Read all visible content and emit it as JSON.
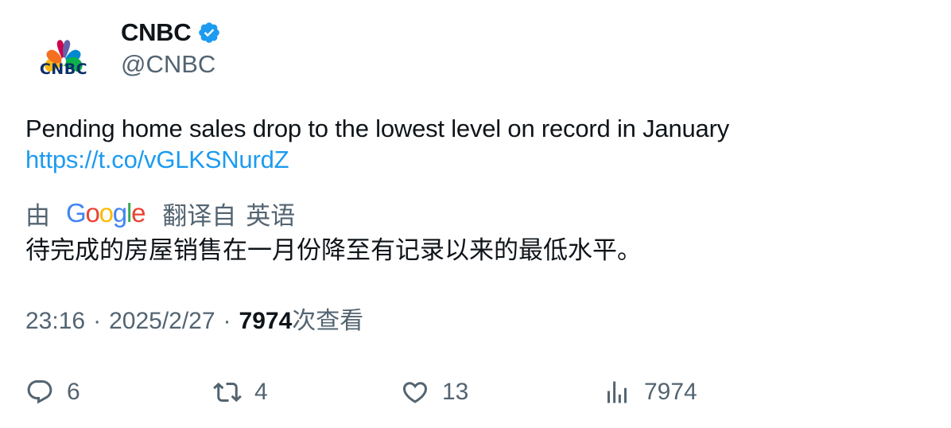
{
  "author": {
    "name": "CNBC",
    "handle": "@CNBC",
    "avatar_text": "CNBC",
    "verified_color": "#1d9bf0"
  },
  "tweet": {
    "text": "Pending home sales drop to the lowest level on record in January",
    "link": "https://t.co/vGLKSNurdZ"
  },
  "translation": {
    "by_label": "由",
    "google_letters": [
      "G",
      "o",
      "o",
      "g",
      "l",
      "e"
    ],
    "google_colors": [
      "#4285F4",
      "#EA4335",
      "#FBBC05",
      "#4285F4",
      "#34A853",
      "#EA4335"
    ],
    "from_label": "翻译自",
    "language": "英语",
    "text": "待完成的房屋销售在一月份降至有记录以来的最低水平。"
  },
  "meta": {
    "time": "23:16",
    "date": "2025/2/27",
    "views": "7974",
    "views_label": "次查看"
  },
  "actions": {
    "replies": "6",
    "retweets": "4",
    "likes": "13",
    "views": "7974"
  },
  "colors": {
    "text_primary": "#0f1419",
    "text_secondary": "#536471",
    "link": "#1d9bf0"
  }
}
